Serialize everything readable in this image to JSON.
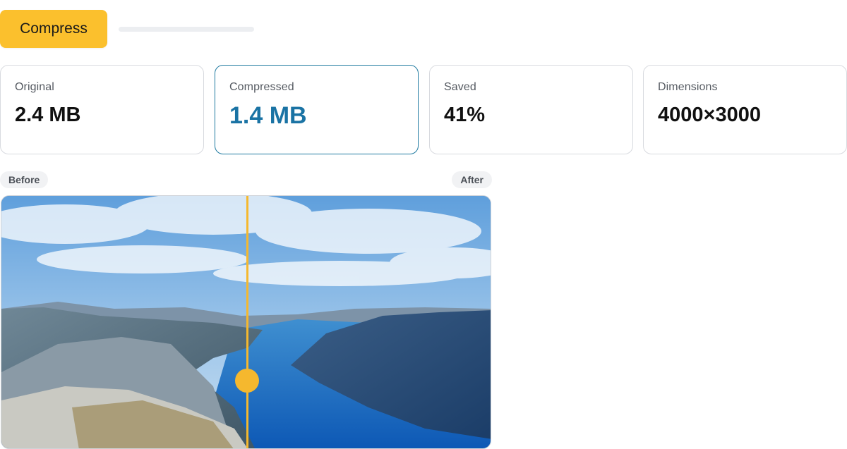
{
  "toolbar": {
    "compress_label": "Compress",
    "progress_fraction": 0,
    "accent_color": "#fbc02d"
  },
  "stats": [
    {
      "label": "Original",
      "value": "2.4 MB"
    },
    {
      "label": "Compressed",
      "value": "1.4 MB",
      "active": true
    },
    {
      "label": "Saved",
      "value": "41%"
    },
    {
      "label": "Dimensions",
      "value": "4000×3000"
    }
  ],
  "comparison": {
    "before_label": "Before",
    "after_label": "After",
    "split_fraction": 0.5,
    "handle_color": "#f5b82e",
    "image_subject": "fjord landscape with cliffs and blue water under cloudy sky"
  },
  "colors": {
    "active_border": "#1f7aa0",
    "active_value": "#1a73a4"
  }
}
